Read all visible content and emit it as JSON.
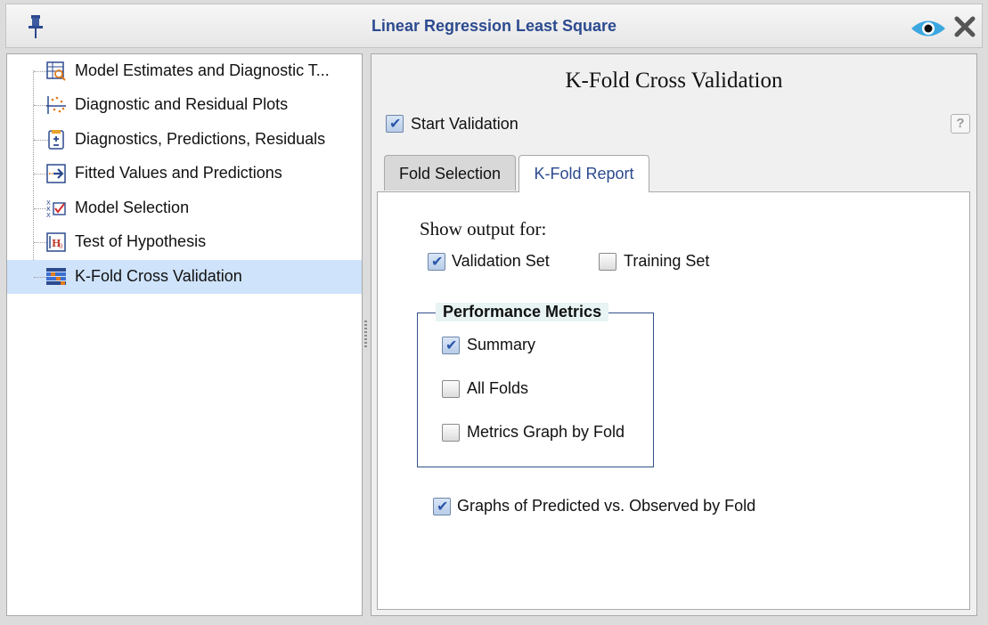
{
  "window": {
    "title": "Linear Regression Least Square",
    "icons": [
      "pin-icon",
      "eye-icon",
      "close-icon"
    ]
  },
  "sidebar": {
    "items": [
      {
        "label": "Model Estimates and Diagnostic T...",
        "icon": "model-estimates-icon",
        "selected": false
      },
      {
        "label": "Diagnostic and Residual Plots",
        "icon": "scatter-plot-icon",
        "selected": false
      },
      {
        "label": "Diagnostics, Predictions, Residuals",
        "icon": "calculator-icon",
        "selected": false
      },
      {
        "label": "Fitted Values and Predictions",
        "icon": "arrow-right-icon",
        "selected": false
      },
      {
        "label": "Model Selection",
        "icon": "model-selection-icon",
        "selected": false
      },
      {
        "label": "Test of Hypothesis",
        "icon": "hypothesis-icon",
        "selected": false
      },
      {
        "label": "K-Fold Cross Validation",
        "icon": "kfold-icon",
        "selected": true
      }
    ]
  },
  "main": {
    "heading": "K-Fold Cross Validation",
    "start_validation": {
      "label": "Start Validation",
      "checked": true
    },
    "help_label": "?",
    "tabs": [
      {
        "label": "Fold Selection",
        "active": false
      },
      {
        "label": "K-Fold Report",
        "active": true
      }
    ],
    "report": {
      "show_output_label": "Show output for:",
      "validation_set": {
        "label": "Validation Set",
        "checked": true
      },
      "training_set": {
        "label": "Training Set",
        "checked": false
      },
      "metrics_group": {
        "title": "Performance Metrics",
        "summary": {
          "label": "Summary",
          "checked": true
        },
        "all_folds": {
          "label": "All Folds",
          "checked": false
        },
        "metrics_graph": {
          "label": "Metrics Graph by Fold",
          "checked": false
        }
      },
      "graphs_predicted": {
        "label": "Graphs of Predicted vs. Observed by Fold",
        "checked": true
      }
    }
  },
  "colors": {
    "title": "#2c4a8f",
    "selection": "#cfe3fb",
    "group_border": "#33508a",
    "checkbox_check": "#2a56a8"
  }
}
